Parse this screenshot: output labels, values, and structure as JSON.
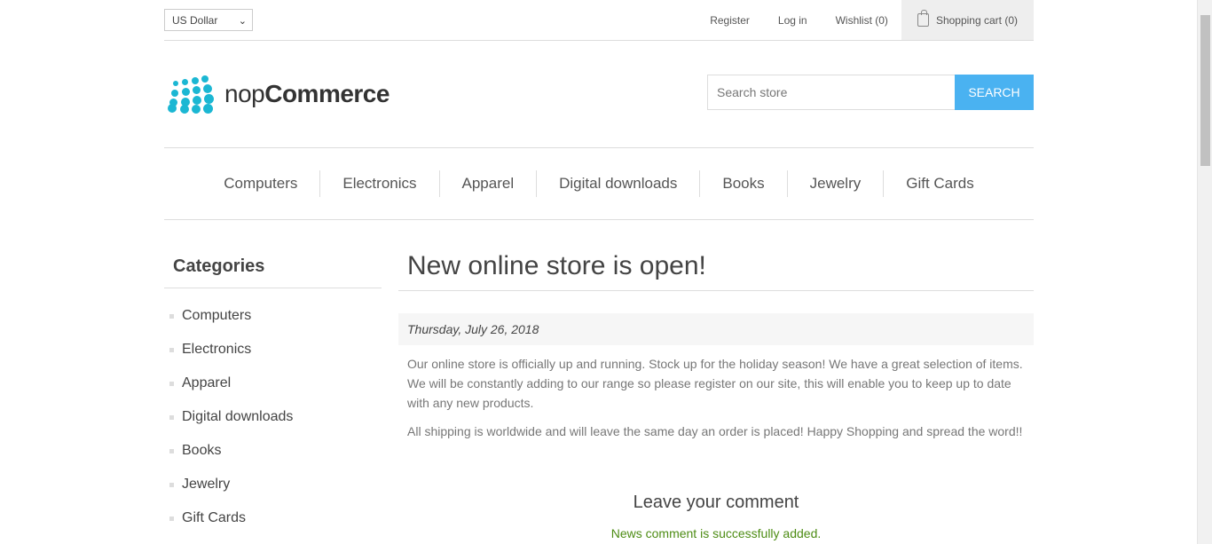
{
  "header": {
    "currency": "US Dollar",
    "links": [
      "Register",
      "Log in",
      "Wishlist (0)"
    ],
    "cart_label": "Shopping cart (0)"
  },
  "logo": {
    "text_light": "nop",
    "text_bold": "Commerce"
  },
  "search": {
    "placeholder": "Search store",
    "button": "SEARCH"
  },
  "menu": [
    "Computers",
    "Electronics",
    "Apparel",
    "Digital downloads",
    "Books",
    "Jewelry",
    "Gift Cards"
  ],
  "sidebar": {
    "title": "Categories",
    "items": [
      "Computers",
      "Electronics",
      "Apparel",
      "Digital downloads",
      "Books",
      "Jewelry",
      "Gift Cards"
    ]
  },
  "news": {
    "title": "New online store is open!",
    "date": "Thursday, July 26, 2018",
    "para1": "Our online store is officially up and running. Stock up for the holiday season! We have a great selection of items. We will be constantly adding to our range so please register on our site, this will enable you to keep up to date with any new products.",
    "para2": "All shipping is worldwide and will leave the same day an order is placed! Happy Shopping and spread the word!!",
    "comment_title": "Leave your comment",
    "success": "News comment is successfully added."
  },
  "colors": {
    "accent": "#4ab2f1",
    "logo": "#1bb7d3",
    "success": "#4d8c14"
  }
}
